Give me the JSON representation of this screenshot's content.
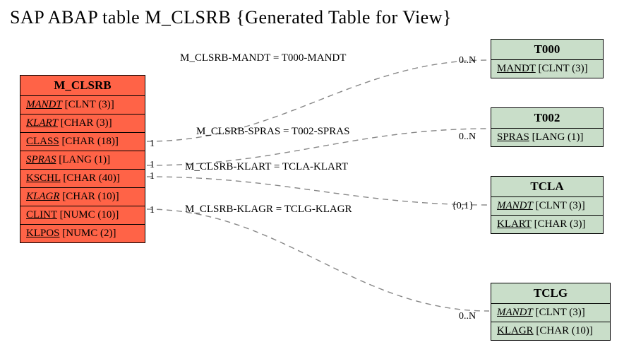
{
  "title": "SAP ABAP table M_CLSRB {Generated Table for View}",
  "main_table": {
    "name": "M_CLSRB",
    "fields": [
      {
        "name": "MANDT",
        "type": "[CLNT (3)]",
        "fk": true
      },
      {
        "name": "KLART",
        "type": "[CHAR (3)]",
        "fk": true
      },
      {
        "name": "CLASS",
        "type": "[CHAR (18)]",
        "fk": false
      },
      {
        "name": "SPRAS",
        "type": "[LANG (1)]",
        "fk": true
      },
      {
        "name": "KSCHL",
        "type": "[CHAR (40)]",
        "fk": false
      },
      {
        "name": "KLAGR",
        "type": "[CHAR (10)]",
        "fk": true
      },
      {
        "name": "CLINT",
        "type": "[NUMC (10)]",
        "fk": false
      },
      {
        "name": "KLPOS",
        "type": "[NUMC (2)]",
        "fk": false
      }
    ]
  },
  "ref_tables": [
    {
      "name": "T000",
      "fields": [
        {
          "name": "MANDT",
          "type": "[CLNT (3)]",
          "fk": false
        }
      ]
    },
    {
      "name": "T002",
      "fields": [
        {
          "name": "SPRAS",
          "type": "[LANG (1)]",
          "fk": false
        }
      ]
    },
    {
      "name": "TCLA",
      "fields": [
        {
          "name": "MANDT",
          "type": "[CLNT (3)]",
          "fk": true
        },
        {
          "name": "KLART",
          "type": "[CHAR (3)]",
          "fk": false
        }
      ]
    },
    {
      "name": "TCLG",
      "fields": [
        {
          "name": "MANDT",
          "type": "[CLNT (3)]",
          "fk": true
        },
        {
          "name": "KLAGR",
          "type": "[CHAR (10)]",
          "fk": false
        }
      ]
    }
  ],
  "relations": [
    {
      "label": "M_CLSRB-MANDT = T000-MANDT",
      "card_left": "1",
      "card_right": "0..N"
    },
    {
      "label": "M_CLSRB-SPRAS = T002-SPRAS",
      "card_left": "1",
      "card_right": "0..N"
    },
    {
      "label": "M_CLSRB-KLART = TCLA-KLART",
      "card_left": "1",
      "card_right": "{0,1}"
    },
    {
      "label": "M_CLSRB-KLAGR = TCLG-KLAGR",
      "card_left": "1",
      "card_right": "0..N"
    }
  ],
  "chart_data": {
    "type": "table",
    "description": "Entity-relationship diagram for SAP ABAP view table M_CLSRB",
    "entities": [
      {
        "name": "M_CLSRB",
        "fields": [
          "MANDT CLNT(3)",
          "KLART CHAR(3)",
          "CLASS CHAR(18)",
          "SPRAS LANG(1)",
          "KSCHL CHAR(40)",
          "KLAGR CHAR(10)",
          "CLINT NUMC(10)",
          "KLPOS NUMC(2)"
        ]
      },
      {
        "name": "T000",
        "fields": [
          "MANDT CLNT(3)"
        ]
      },
      {
        "name": "T002",
        "fields": [
          "SPRAS LANG(1)"
        ]
      },
      {
        "name": "TCLA",
        "fields": [
          "MANDT CLNT(3)",
          "KLART CHAR(3)"
        ]
      },
      {
        "name": "TCLG",
        "fields": [
          "MANDT CLNT(3)",
          "KLAGR CHAR(10)"
        ]
      }
    ],
    "relationships": [
      {
        "from": "M_CLSRB.MANDT",
        "to": "T000.MANDT",
        "cardinality": "1 to 0..N"
      },
      {
        "from": "M_CLSRB.SPRAS",
        "to": "T002.SPRAS",
        "cardinality": "1 to 0..N"
      },
      {
        "from": "M_CLSRB.KLART",
        "to": "TCLA.KLART",
        "cardinality": "1 to {0,1}"
      },
      {
        "from": "M_CLSRB.KLAGR",
        "to": "TCLG.KLAGR",
        "cardinality": "1 to 0..N"
      }
    ]
  }
}
